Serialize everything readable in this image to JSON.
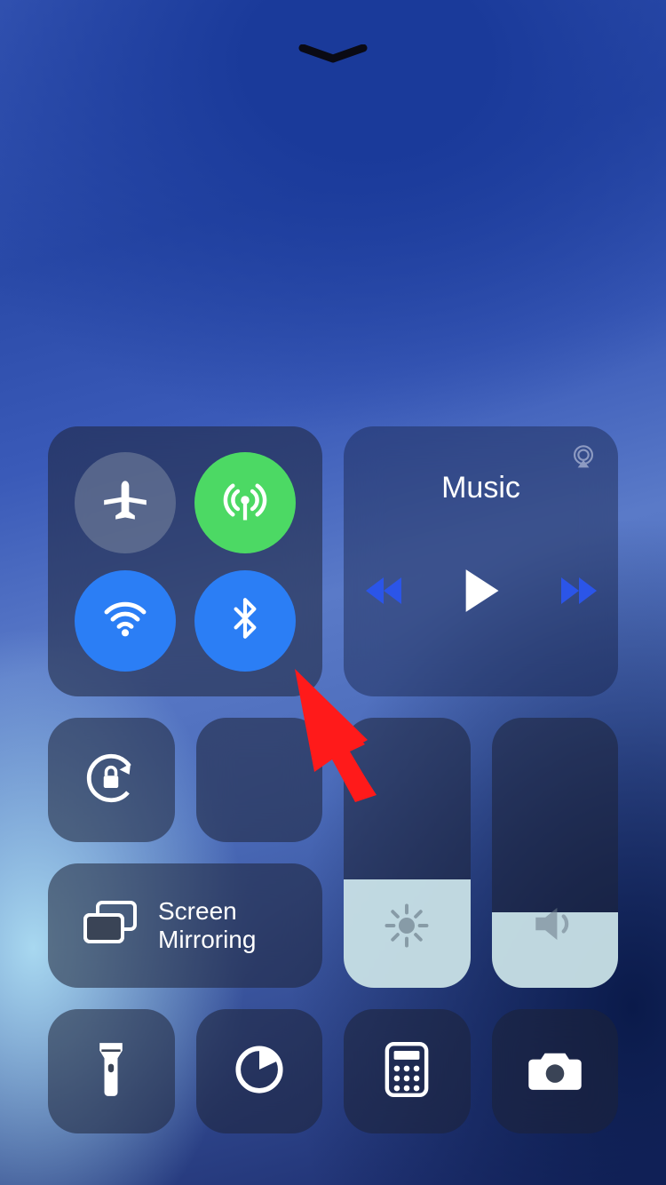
{
  "media": {
    "title": "Music"
  },
  "mirroring": {
    "label_line1": "Screen",
    "label_line2": "Mirroring"
  },
  "toggles": {
    "airplane": {
      "on": false
    },
    "cellular": {
      "on": true
    },
    "wifi": {
      "on": true
    },
    "bluetooth": {
      "on": true
    },
    "orientation_lock": {
      "on": false
    },
    "do_not_disturb": {
      "on": false
    }
  },
  "sliders": {
    "brightness_percent": 40,
    "volume_percent": 28
  },
  "colors": {
    "toggle_on_green": "#4cd964",
    "toggle_on_blue": "#2b7ef5",
    "media_accent": "#2b55e8",
    "arrow": "#ff1a1a"
  }
}
